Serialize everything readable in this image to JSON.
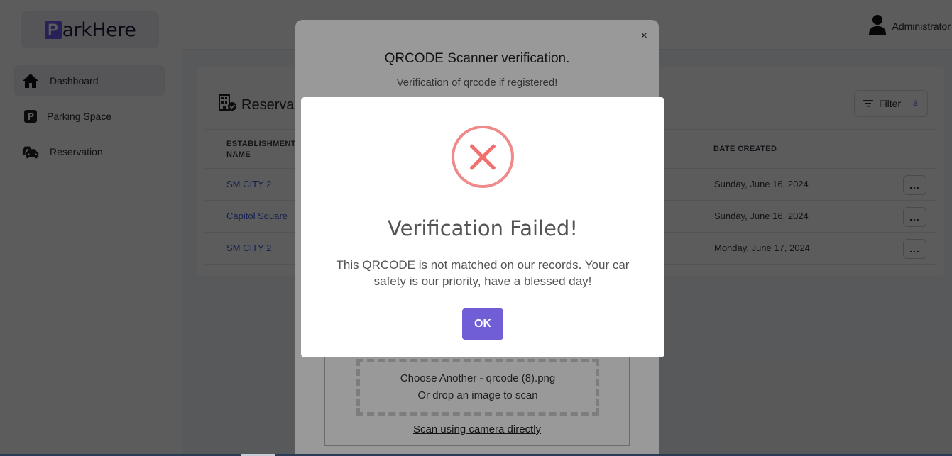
{
  "brand": {
    "logo_letter": "P",
    "name": "arkHere"
  },
  "sidebar": {
    "items": [
      {
        "label": "Dashboard",
        "icon": "home-icon",
        "active": true
      },
      {
        "label": "Parking Space",
        "icon": "parking-icon",
        "active": false
      },
      {
        "label": "Reservation",
        "icon": "cars-icon",
        "active": false
      }
    ]
  },
  "header": {
    "user_label": "Administrator",
    "user_icon": "user-icon"
  },
  "page": {
    "title": "Reservati",
    "filter_label": "Filter",
    "filter_count": "3",
    "columns": {
      "establishment": "ESTABLISHMENT NAME",
      "date_created": "DATE CREATED"
    },
    "rows": [
      {
        "establishment": "SM CITY 2",
        "date_created": "Sunday, June 16, 2024",
        "actions": "..."
      },
      {
        "establishment": "Capitol Square",
        "date_created": "Sunday, June 16, 2024",
        "actions": "..."
      },
      {
        "establishment": "SM CITY 2",
        "date_created": "Monday, June 17, 2024",
        "actions": "..."
      }
    ]
  },
  "scanner_modal": {
    "close": "×",
    "title": "QRCODE Scanner verification.",
    "subtitle": "Verification of qrcode if registered!",
    "drop_line1": "Choose Another - qrcode (8).png",
    "drop_line2": "Or drop an image to scan",
    "camera_link": "Scan using camera directly"
  },
  "alert": {
    "icon": "error-x-icon",
    "icon_color": "#f27474",
    "title": "Verification Failed!",
    "message": "This QRCODE is not matched on our records. Your car safety is our priority, have a blessed day!",
    "ok_label": "OK",
    "ok_color": "#7066e0"
  },
  "colors": {
    "accent": "#6f5ef2",
    "link": "#3f5be0"
  }
}
